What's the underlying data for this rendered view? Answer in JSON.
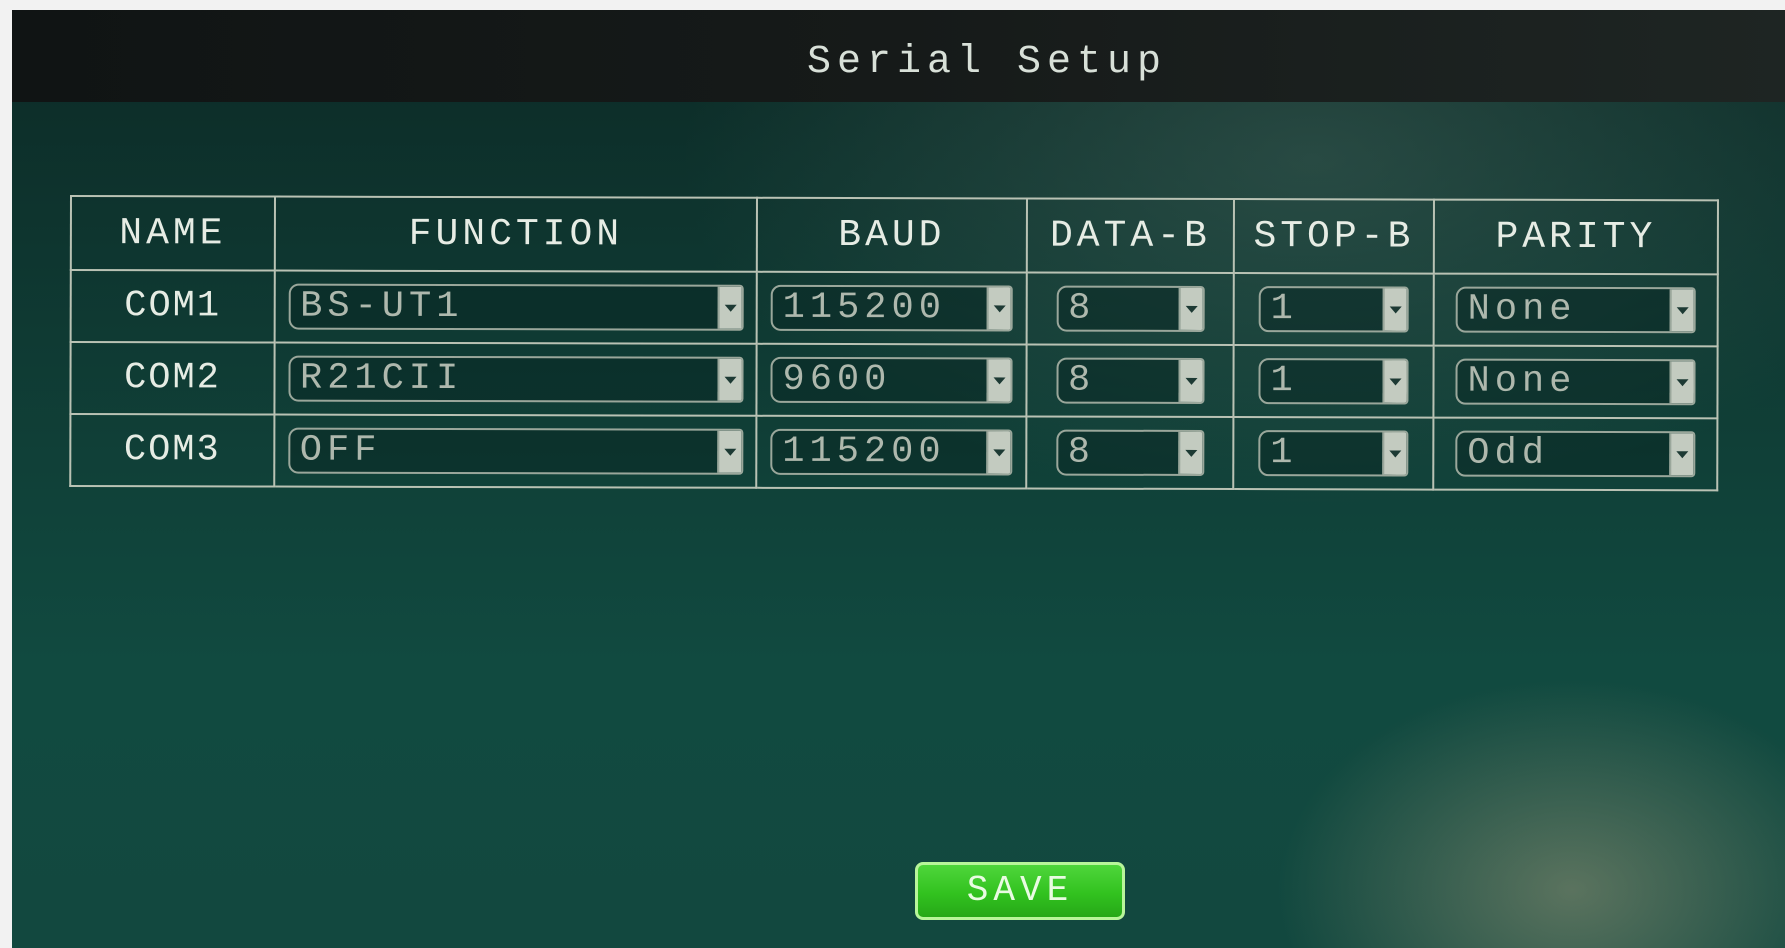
{
  "window": {
    "title": "Serial Setup"
  },
  "table": {
    "headers": [
      "NAME",
      "FUNCTION",
      "BAUD",
      "DATA-B",
      "STOP-B",
      "PARITY"
    ],
    "rows": [
      {
        "name": "COM1",
        "function": "BS-UT1",
        "baud": "115200",
        "data_bits": "8",
        "stop_bits": "1",
        "parity": "None"
      },
      {
        "name": "COM2",
        "function": "R21CII",
        "baud": "9600",
        "data_bits": "8",
        "stop_bits": "1",
        "parity": "None"
      },
      {
        "name": "COM3",
        "function": "OFF",
        "baud": "115200",
        "data_bits": "8",
        "stop_bits": "1",
        "parity": "Odd"
      }
    ]
  },
  "actions": {
    "save_label": "SAVE"
  },
  "colors": {
    "background": "#114a40",
    "title_bar": "#161a19",
    "save_button": "#32c21f",
    "grid_line": "#b9c2b4"
  },
  "icons": {
    "dropdown": "chevron-down-icon"
  }
}
